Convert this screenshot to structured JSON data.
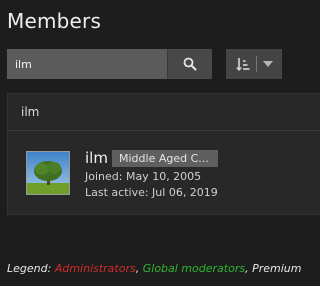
{
  "page": {
    "title": "Members"
  },
  "search": {
    "value": "ilm"
  },
  "icons": {
    "search": "search-icon",
    "sort": "sort-icon",
    "dropdown": "chevron-down-icon"
  },
  "list": {
    "header": "ilm",
    "member": {
      "name": "ilm",
      "title": "Middle Aged C...",
      "joined": "Joined: May 10, 2005",
      "last_active": "Last active: Jul 06, 2019"
    }
  },
  "legend": {
    "label": "Legend: ",
    "administrators": "Administrators",
    "sep1": ", ",
    "global_moderators": "Global moderators",
    "sep2": ", ",
    "premium": "Premium"
  },
  "colors": {
    "administrators": "#d12b2b",
    "global_moderators": "#2fb52f"
  }
}
